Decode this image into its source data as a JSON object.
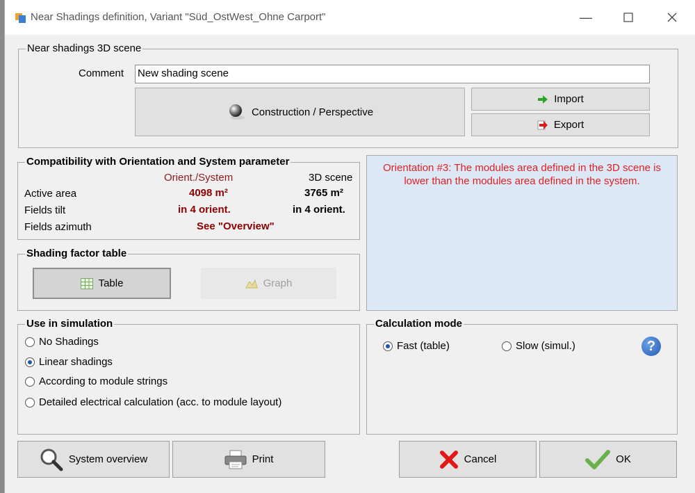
{
  "window": {
    "title": "Near Shadings definition, Variant \"Süd_OstWest_Ohne Carport\"",
    "minimize_icon": "minimize-icon",
    "maximize_icon": "maximize-icon",
    "close_icon": "close-icon"
  },
  "scene": {
    "group_title": "Near shadings 3D scene",
    "comment_label": "Comment",
    "comment_value": "New shading scene",
    "construction_label": "Construction / Perspective",
    "import_label": "Import",
    "export_label": "Export"
  },
  "compat": {
    "group_title": "Compatibility with Orientation and System parameter",
    "col_system": "Orient./System",
    "col_scene": "3D scene",
    "rows": [
      {
        "label": "Active area",
        "system": "4098 m²",
        "scene": "3765 m²"
      },
      {
        "label": "Fields tilt",
        "system": "in 4 orient.",
        "scene": "in 4 orient."
      },
      {
        "label": "Fields azimuth",
        "system": "See \"Overview\"",
        "scene": ""
      }
    ]
  },
  "message": {
    "line1": "Orientation #3:  The modules area defined in the 3D scene is",
    "line2": "lower than the modules area defined in the system."
  },
  "shading_table": {
    "group_title": "Shading factor table",
    "table_label": "Table",
    "graph_label": "Graph"
  },
  "simulation": {
    "group_title": "Use in simulation",
    "options": [
      {
        "label": "No Shadings",
        "selected": false
      },
      {
        "label": "Linear shadings",
        "selected": true
      },
      {
        "label": "According to module strings",
        "selected": false
      },
      {
        "label": "Detailed electrical calculation (acc. to module layout)",
        "selected": false
      }
    ]
  },
  "calc_mode": {
    "group_title": "Calculation mode",
    "fast_label": "Fast (table)",
    "slow_label": "Slow (simul.)",
    "fast_selected": true,
    "help": "?"
  },
  "footer": {
    "overview_label": "System overview",
    "print_label": "Print",
    "cancel_label": "Cancel",
    "ok_label": "OK"
  },
  "colors": {
    "message_bg": "#dde8f7",
    "message_text": "#e02020",
    "value_red": "#8b0000",
    "radio_accent": "#1a56b0"
  }
}
